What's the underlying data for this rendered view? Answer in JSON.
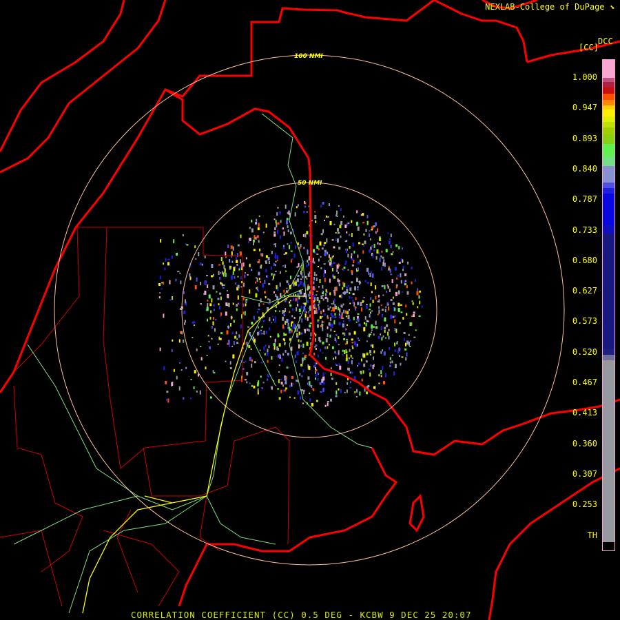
{
  "header": {
    "title": "NEXLAB-College of DuPage",
    "logo_icon": "nexlab-logo-icon"
  },
  "product_code": "DCC",
  "units": "[CC]",
  "rings": [
    {
      "label": "100 NMI",
      "nmi": 100
    },
    {
      "label": "50 NMI",
      "nmi": 50
    }
  ],
  "colorbar": {
    "labels": [
      "1.000",
      "0.947",
      "0.893",
      "0.840",
      "0.787",
      "0.733",
      "0.680",
      "0.627",
      "0.573",
      "0.520",
      "0.467",
      "0.413",
      "0.360",
      "0.307",
      "0.253",
      "TH"
    ]
  },
  "footer": "CORRELATION COEFFICIENT (CC) 0.5 DEG - KCBW 9 DEC 25 20:07",
  "colors": {
    "border": "#ff0000",
    "county": "#cc0000",
    "ring": "#ffc0a0",
    "road": "#80e080",
    "highway": "#ffff00",
    "text": "#ffff00"
  }
}
